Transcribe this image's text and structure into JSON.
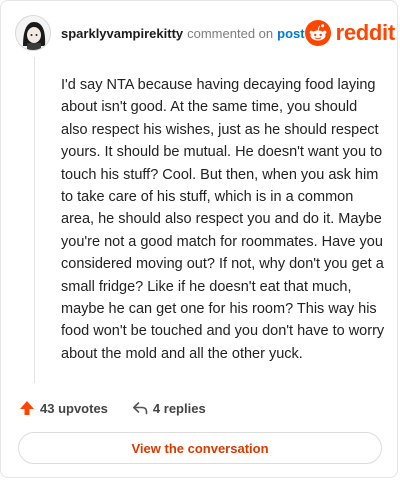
{
  "comment": {
    "username": "sparklyvampirekitty",
    "action_text": "commented on",
    "post_link": "post",
    "body": "I'd say NTA because having decaying food laying about isn't good. At the same time, you should also respect his wishes, just as he should respect yours. It should be mutual. He doesn't want you to touch his stuff? Cool. But then, when you ask him to take care of his stuff, which is in a common area, he should also respect you and do it. Maybe you're not a good match for roommates. Have you considered moving out? If not, why don't you get a small fridge? Like if he doesn't eat that much, maybe he can get one for his room? This way his food won't be touched and you don't have to worry about the mold and all the other yuck."
  },
  "brand": {
    "wordmark": "reddit",
    "color": "#ff4500",
    "icon": "reddit-snoo-icon"
  },
  "actions": {
    "upvotes": "43 upvotes",
    "upvote_icon": "upvote-arrow-icon",
    "upvote_color": "#ff4500",
    "replies": "4 replies",
    "reply_icon": "reply-icon"
  },
  "view_button": {
    "label": "View the conversation",
    "color": "#d93a00"
  }
}
